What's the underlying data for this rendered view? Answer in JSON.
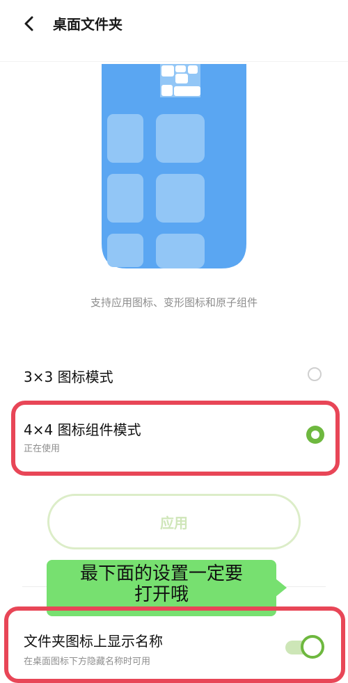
{
  "header": {
    "title": "桌面文件夹",
    "back_icon": "back-arrow-icon"
  },
  "preview": {
    "caption": "支持应用图标、变形图标和原子组件",
    "primary_color": "#5aa6f2",
    "tile_color": "#92c6f6"
  },
  "options": [
    {
      "title": "3×3 图标模式",
      "subtitle": "",
      "selected": false
    },
    {
      "title": "4×4 图标组件模式",
      "subtitle": "正在使用",
      "selected": true
    }
  ],
  "apply_button": {
    "label": "应用"
  },
  "annotation": {
    "line1": "最下面的设置一定要",
    "line2": "打开哦"
  },
  "setting": {
    "title": "文件夹图标上显示名称",
    "subtitle": "在桌面图标下方隐藏名称时可用",
    "toggle_on": true
  },
  "colors": {
    "accent": "#6eb83f",
    "highlight": "#e84657",
    "annotation_bg": "#77e070"
  }
}
